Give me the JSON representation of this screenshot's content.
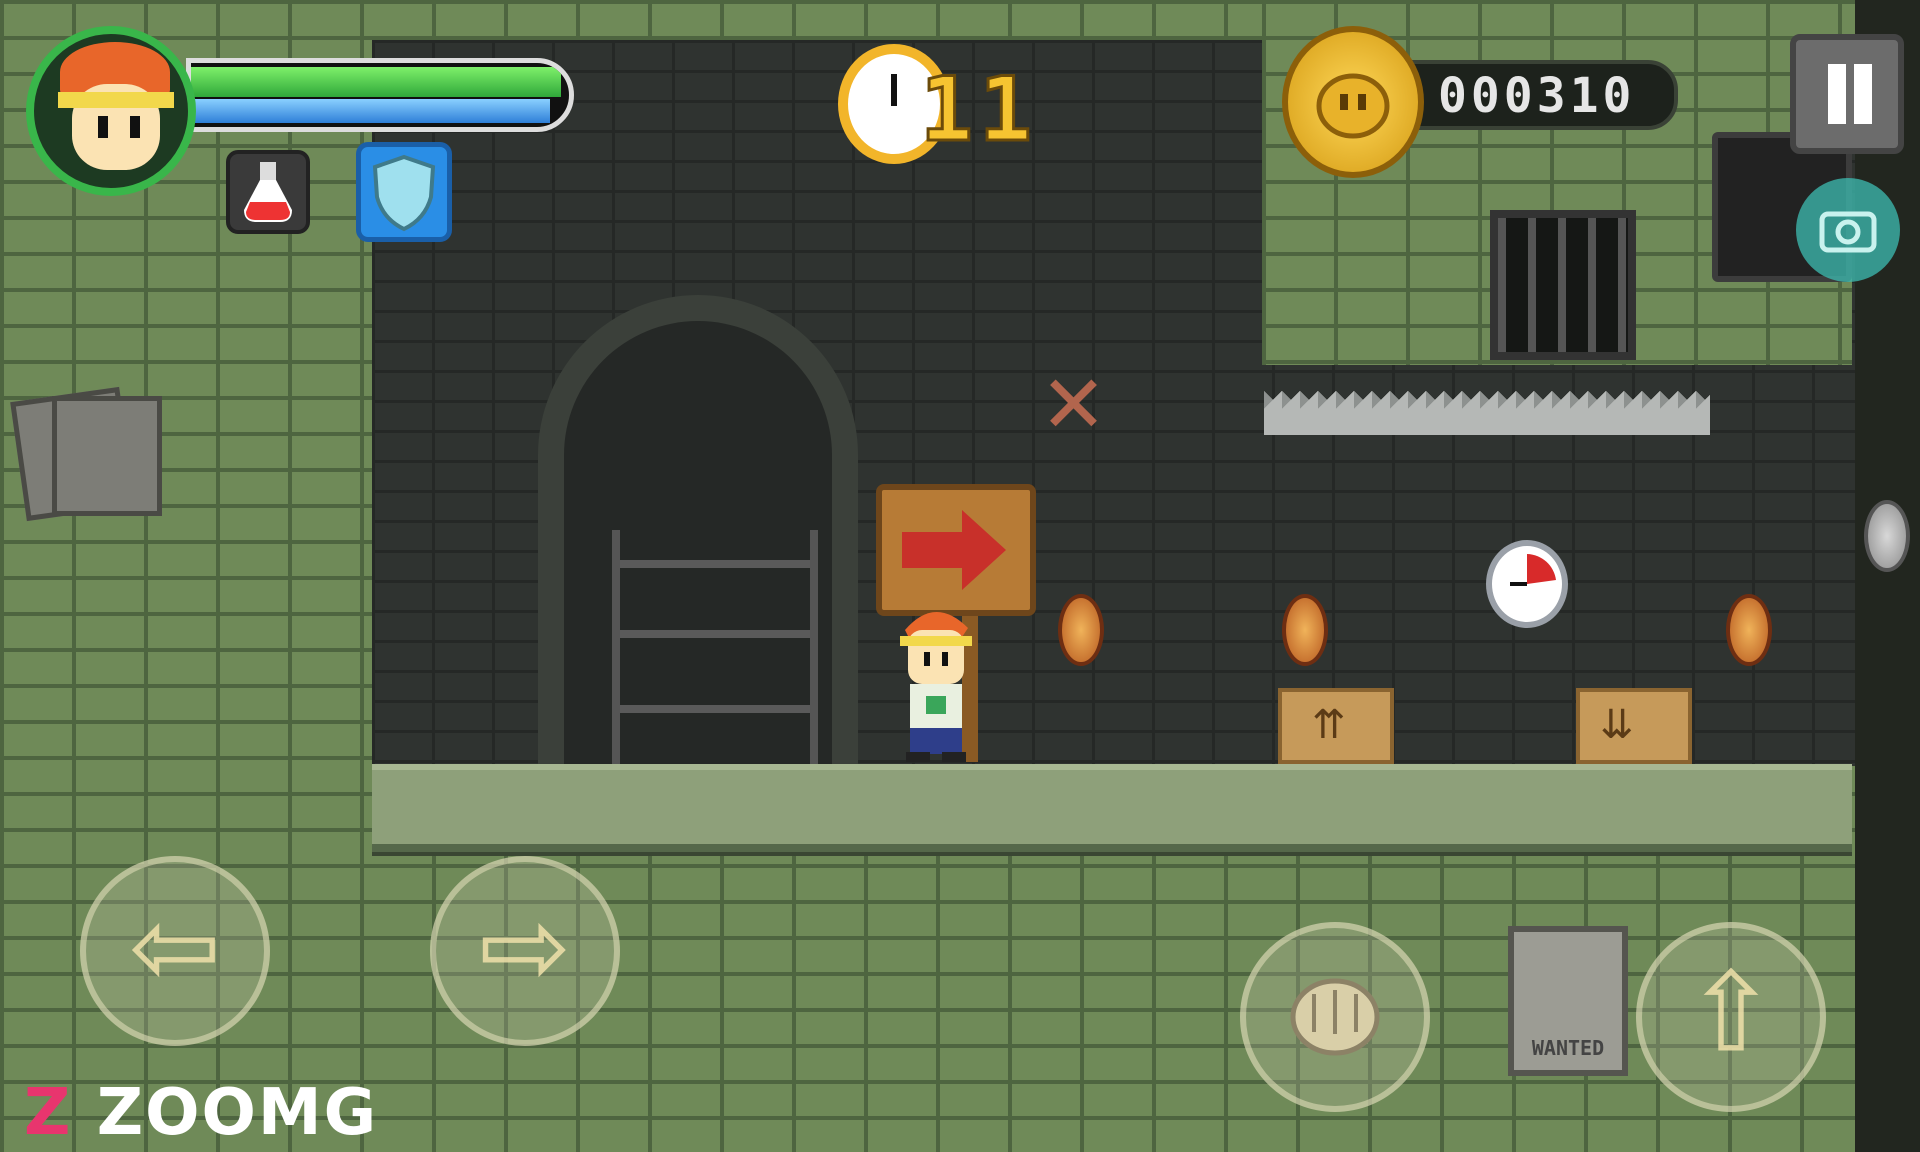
{
  "hud": {
    "health_fraction": 0.98,
    "mana_fraction": 0.95,
    "inventory": [
      {
        "name": "potion",
        "icon": "potion-icon"
      },
      {
        "name": "shield",
        "icon": "shield-icon"
      }
    ],
    "timer_value": "11",
    "score_value": "000310",
    "pause_icon": "pause-icon",
    "camera_icon": "camera-icon"
  },
  "controls": {
    "left_icon": "left-arrow-icon",
    "right_icon": "right-arrow-icon",
    "punch_icon": "fist-icon",
    "jump_icon": "up-arrow-icon",
    "left_glyph": "⇦",
    "right_glyph": "⇨",
    "jump_glyph": "⇧"
  },
  "scene": {
    "wanted_text": "WANTED",
    "box_up_glyph": "⇈",
    "box_down_glyph": "⇊",
    "x_mark": "✕"
  },
  "watermark": {
    "mark": "Z",
    "text": "ZOOMG"
  },
  "colors": {
    "health": "#39c64a",
    "mana": "#2e7fd8",
    "timer": "#f6c431",
    "coin": "#f0b35a"
  }
}
